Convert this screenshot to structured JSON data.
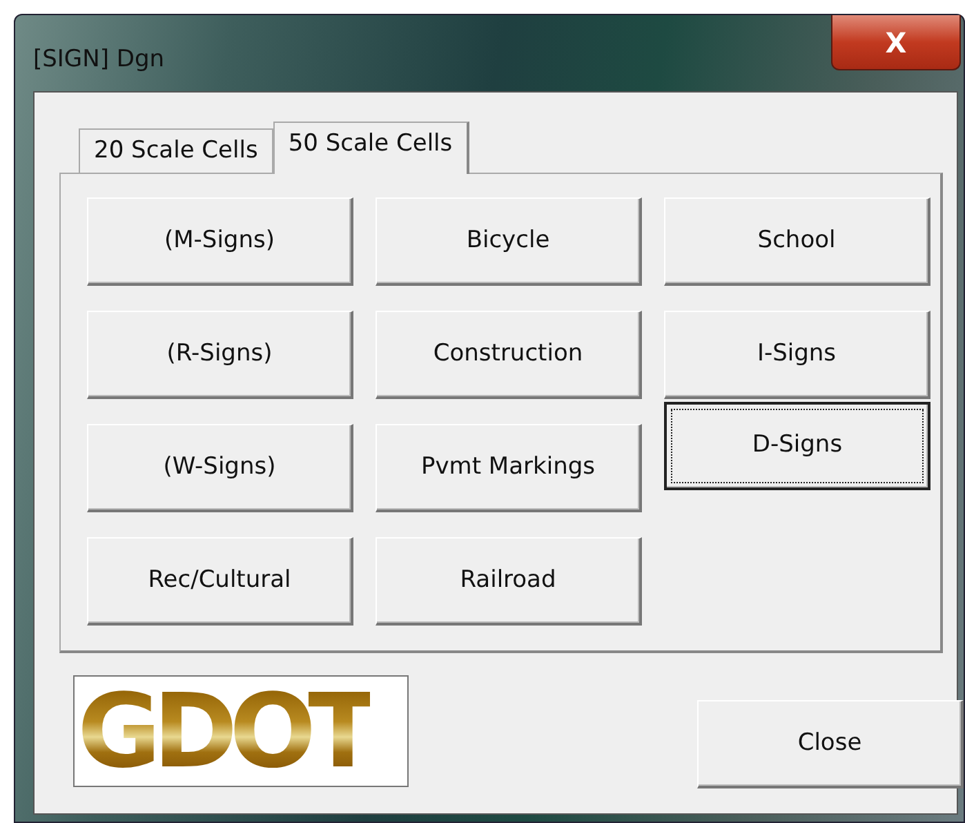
{
  "window": {
    "title": "[SIGN] Dgn",
    "close_glyph": "X"
  },
  "tabs": [
    {
      "label": "20 Scale Cells",
      "selected": false
    },
    {
      "label": "50 Scale Cells",
      "selected": true
    }
  ],
  "button_columns": [
    {
      "buttons": [
        {
          "label": "(M-Signs)",
          "focused": false
        },
        {
          "label": "(R-Signs)",
          "focused": false
        },
        {
          "label": "(W-Signs)",
          "focused": false
        },
        {
          "label": "Rec/Cultural",
          "focused": false
        }
      ]
    },
    {
      "buttons": [
        {
          "label": "Bicycle",
          "focused": false
        },
        {
          "label": "Construction",
          "focused": false
        },
        {
          "label": "Pvmt Markings",
          "focused": false
        },
        {
          "label": "Railroad",
          "focused": false
        }
      ]
    },
    {
      "buttons": [
        {
          "label": "School",
          "focused": false
        },
        {
          "label": "I-Signs",
          "focused": false
        },
        {
          "label": "D-Signs",
          "focused": true
        }
      ]
    }
  ],
  "logo": {
    "text": "GDOT"
  },
  "close_button": {
    "label": "Close"
  }
}
